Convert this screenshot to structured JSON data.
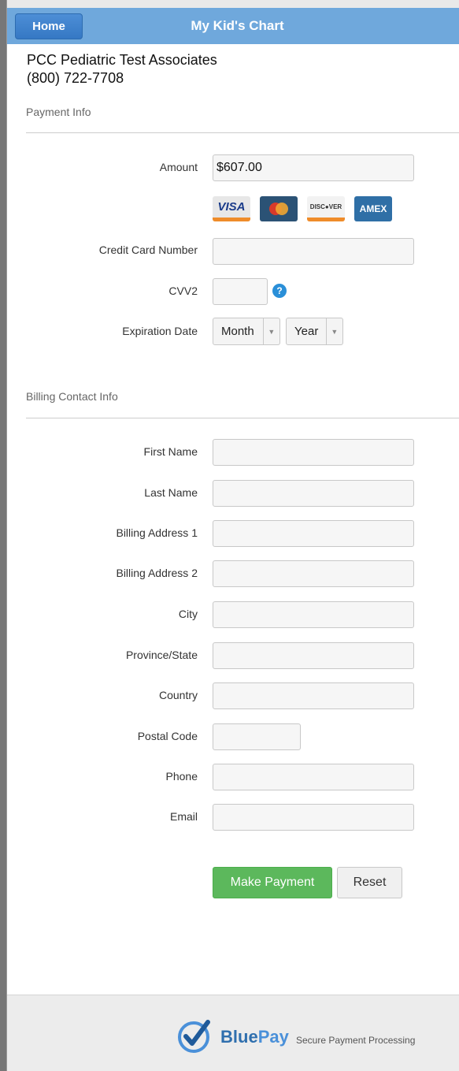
{
  "header": {
    "home_label": "Home",
    "title": "My Kid's Chart"
  },
  "practice": {
    "name": "PCC Pediatric Test Associates",
    "phone": "(800) 722-7708"
  },
  "payment": {
    "section_title": "Payment Info",
    "amount_label": "Amount",
    "amount_value": "$607.00",
    "cards": [
      "VISA",
      "MasterCard",
      "DISC●VER",
      "AMEX"
    ],
    "cc_number_label": "Credit Card Number",
    "cvv_label": "CVV2",
    "cvv_help": "?",
    "expiration_label": "Expiration Date",
    "month_value": "Month",
    "year_value": "Year"
  },
  "billing": {
    "section_title": "Billing Contact Info",
    "first_name_label": "First Name",
    "last_name_label": "Last Name",
    "address1_label": "Billing Address 1",
    "address2_label": "Billing Address 2",
    "city_label": "City",
    "state_label": "Province/State",
    "country_label": "Country",
    "postal_label": "Postal Code",
    "phone_label": "Phone",
    "email_label": "Email"
  },
  "actions": {
    "pay_label": "Make Payment",
    "reset_label": "Reset"
  },
  "footer": {
    "brand_blue": "Blue",
    "brand_pay": "Pay",
    "tagline": "Secure Payment Processing"
  },
  "colors": {
    "header": "#6fa8dc",
    "pay_button": "#5cb85c",
    "help_icon": "#2a8fd8"
  }
}
